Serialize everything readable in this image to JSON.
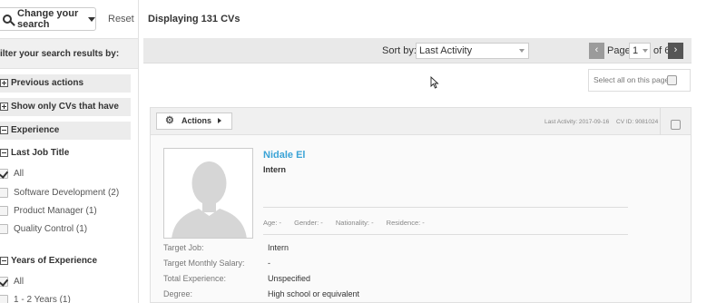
{
  "toolbar": {
    "change_search_label": "Change your search",
    "reset_label": "Reset",
    "displaying_label": "Displaying 131 CVs"
  },
  "sidebar": {
    "filter_heading": "ilter your search results by:",
    "previous_actions": "Previous actions",
    "show_only": "Show only CVs that have",
    "experience": "Experience",
    "last_job_title": "Last Job Title",
    "job_options": [
      {
        "label": "All",
        "checked": true
      },
      {
        "label": "Software Development (2)",
        "checked": false
      },
      {
        "label": "Product Manager (1)",
        "checked": false
      },
      {
        "label": "Quality Control (1)",
        "checked": false
      }
    ],
    "years_of_experience": "Years of Experience",
    "years_options": [
      {
        "label": "All",
        "checked": true
      },
      {
        "label": "1 - 2 Years (1)",
        "checked": false
      }
    ]
  },
  "sortbar": {
    "sort_by_label": "Sort by:",
    "sort_value": "Last Activity",
    "page_word": "Page",
    "page_value": "1",
    "page_of": "of 6",
    "prev_glyph": "‹",
    "next_glyph": "›"
  },
  "select_all_label": "Select all on this page",
  "card": {
    "actions_label": "Actions",
    "last_activity": "Last Activity: 2017-09-16",
    "cv_id": "CV ID: 9081024",
    "name": "Nidale El",
    "job_title": "Intern",
    "demographics": {
      "age": "Age: -",
      "gender": "Gender: -",
      "nationality": "Nationality: -",
      "residence": "Residence: -"
    },
    "fields": [
      {
        "label": "Target Job:",
        "value": "Intern"
      },
      {
        "label": "Target Monthly Salary:",
        "value": "-"
      },
      {
        "label": "Total Experience:",
        "value": "Unspecified"
      },
      {
        "label": "Degree:",
        "value": "High school or equivalent"
      }
    ]
  },
  "colors": {
    "link": "#3aa3d6",
    "pager_next": "#555555",
    "pager_prev": "#9b9b9b"
  }
}
